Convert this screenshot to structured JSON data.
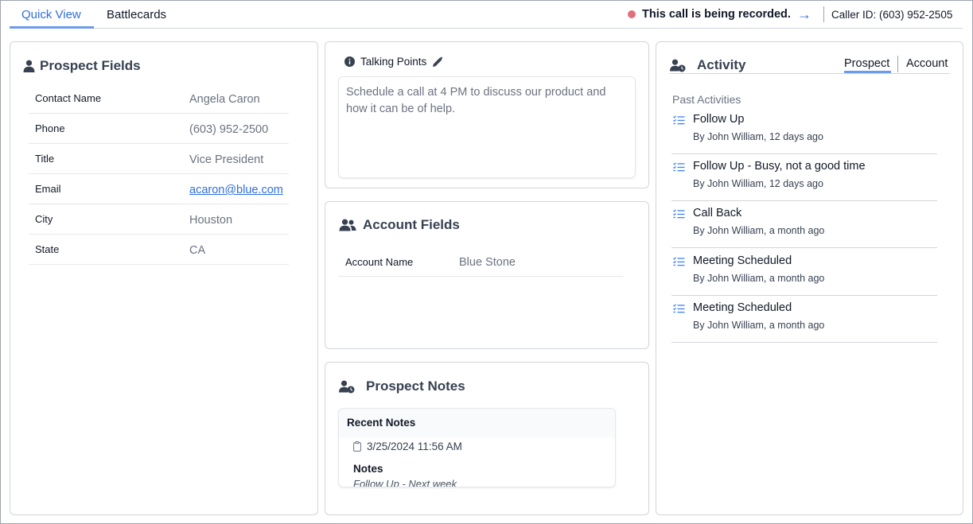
{
  "tabs": [
    {
      "label": "Quick View",
      "active": true
    },
    {
      "label": "Battlecards",
      "active": false
    }
  ],
  "recording": {
    "text": "This call is being recorded.",
    "arrow": "→",
    "dot_color": "#e0707c"
  },
  "caller_id": "Caller ID: (603) 952-2505",
  "accent_color": "#2f6fdb",
  "prospect_fields": {
    "title": "Prospect Fields",
    "icon": "user-icon",
    "rows": [
      {
        "label": "Contact Name",
        "value": "Angela Caron"
      },
      {
        "label": "Phone",
        "value": "(603) 952-2500"
      },
      {
        "label": "Title",
        "value": "Vice President"
      },
      {
        "label": "Email",
        "value": "acaron@blue.com"
      },
      {
        "label": "City",
        "value": "Houston"
      },
      {
        "label": "State",
        "value": "CA"
      }
    ]
  },
  "talking_points": {
    "title": "Talking Points",
    "text": "Schedule a call at 4 PM to discuss our product and how it can be of help."
  },
  "account_fields": {
    "title": "Account Fields",
    "icon": "users-icon",
    "rows": [
      {
        "label": "Account Name",
        "value": "Blue Stone"
      }
    ]
  },
  "prospect_notes": {
    "title": "Prospect Notes",
    "recent_label": "Recent Notes",
    "date": "3/25/2024 11:56 AM",
    "notes_label": "Notes",
    "notes_text": "Follow Up - Next week"
  },
  "activity": {
    "title": "Activity",
    "tabs": [
      {
        "label": "Prospect",
        "active": true
      },
      {
        "label": "Account",
        "active": false
      }
    ],
    "past_label": "Past Activities",
    "items": [
      {
        "title": "Follow Up",
        "sub": "By John William, 12 days ago"
      },
      {
        "title": "Follow Up - Busy, not a good time",
        "sub": "By John William, 12 days ago"
      },
      {
        "title": "Call Back",
        "sub": "By John William, a month ago"
      },
      {
        "title": "Meeting Scheduled",
        "sub": "By John William, a month ago"
      },
      {
        "title": "Meeting Scheduled",
        "sub": "By John William, a month ago"
      }
    ]
  }
}
